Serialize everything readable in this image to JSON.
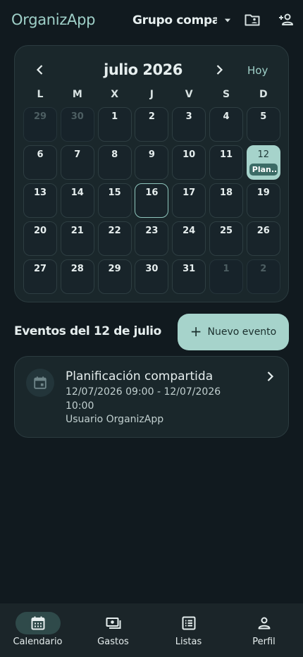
{
  "app": {
    "title": "OrganizApp"
  },
  "header": {
    "group_label": "Grupo compa..."
  },
  "colors": {
    "accent": "#a6d3cb",
    "accent_text": "#9fd0c8",
    "background": "#111a1f",
    "card": "#1a272b",
    "event_chip": "#3c6b66"
  },
  "icons": {
    "group_dropdown": "caret-down-icon",
    "shared_folder": "folder-account-icon",
    "add_member": "account-plus-icon",
    "event": "calendar-icon"
  },
  "calendar": {
    "month_title": "julio 2026",
    "today_label": "Hoy",
    "weekdays": [
      "L",
      "M",
      "X",
      "J",
      "V",
      "S",
      "D"
    ],
    "days": [
      {
        "label": "29",
        "outside": true
      },
      {
        "label": "30",
        "outside": true
      },
      {
        "label": "1"
      },
      {
        "label": "2"
      },
      {
        "label": "3"
      },
      {
        "label": "4"
      },
      {
        "label": "5"
      },
      {
        "label": "6"
      },
      {
        "label": "7"
      },
      {
        "label": "8"
      },
      {
        "label": "9"
      },
      {
        "label": "10"
      },
      {
        "label": "11"
      },
      {
        "label": "12",
        "selected": true,
        "event": "Plan..."
      },
      {
        "label": "13"
      },
      {
        "label": "14"
      },
      {
        "label": "15"
      },
      {
        "label": "16",
        "today": true
      },
      {
        "label": "17"
      },
      {
        "label": "18"
      },
      {
        "label": "19"
      },
      {
        "label": "20"
      },
      {
        "label": "21"
      },
      {
        "label": "22"
      },
      {
        "label": "23"
      },
      {
        "label": "24"
      },
      {
        "label": "25"
      },
      {
        "label": "26"
      },
      {
        "label": "27"
      },
      {
        "label": "28"
      },
      {
        "label": "29"
      },
      {
        "label": "30"
      },
      {
        "label": "31"
      },
      {
        "label": "1",
        "outside": true
      },
      {
        "label": "2",
        "outside": true
      }
    ]
  },
  "events_section": {
    "title": "Eventos del 12 de julio",
    "new_event_label": "Nuevo evento",
    "events": [
      {
        "name": "Planificación compartida",
        "time_range": "12/07/2026 09:00 - 12/07/2026 10:00",
        "owner": "Usuario OrganizApp"
      }
    ]
  },
  "bottom_nav": {
    "items": [
      {
        "label": "Calendario",
        "icon": "calendar-icon",
        "active": true
      },
      {
        "label": "Gastos",
        "icon": "cash-icon"
      },
      {
        "label": "Listas",
        "icon": "list-icon"
      },
      {
        "label": "Perfil",
        "icon": "person-icon"
      }
    ]
  }
}
